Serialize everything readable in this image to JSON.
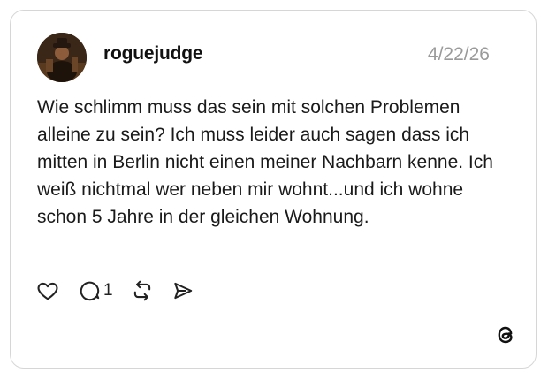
{
  "post": {
    "username": "roguejudge",
    "timestamp": "4/22/26",
    "text": "Wie schlimm muss das sein mit solchen Problemen alleine zu sein? Ich muss leider auch sagen dass ich mitten in Berlin nicht einen meiner Nachbarn kenne. Ich weiß nichtmal wer neben mir wohnt...und ich wohne schon 5 Jahre in der gleichen Wohnung.",
    "reply_count": "1"
  },
  "actions": [
    {
      "name": "like",
      "icon": "heart-icon"
    },
    {
      "name": "reply",
      "icon": "comment-icon"
    },
    {
      "name": "repost",
      "icon": "repost-icon"
    },
    {
      "name": "share",
      "icon": "send-icon"
    }
  ],
  "brand": {
    "icon": "threads-logo-icon"
  },
  "colors": {
    "text": "#1a1a1a",
    "muted": "#9a9a9a",
    "border": "#d6d6d6",
    "background": "#ffffff"
  }
}
